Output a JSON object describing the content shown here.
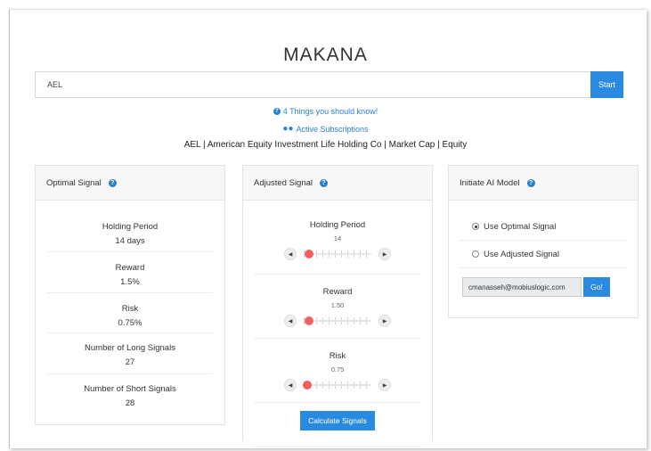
{
  "app": {
    "title": "MAKANA"
  },
  "search": {
    "value": "AEL",
    "start_label": "Start"
  },
  "links": {
    "things": "4 Things you should know!",
    "subscriptions": "Active Subscriptions"
  },
  "info_line": "AEL | American Equity Investment Life Holding Co | Market Cap | Equity",
  "optimal": {
    "title": "Optimal Signal",
    "items": [
      {
        "label": "Holding Period",
        "value": "14 days"
      },
      {
        "label": "Reward",
        "value": "1.5%"
      },
      {
        "label": "Risk",
        "value": "0.75%"
      },
      {
        "label": "Number of Long Signals",
        "value": "27"
      },
      {
        "label": "Number of Short Signals",
        "value": "28"
      }
    ]
  },
  "adjusted": {
    "title": "Adjusted Signal",
    "sliders": [
      {
        "label": "Holding Period",
        "value": "14",
        "position": 0.08
      },
      {
        "label": "Reward",
        "value": "1.50",
        "position": 0.08
      },
      {
        "label": "Risk",
        "value": "0.75",
        "position": 0.05
      }
    ],
    "calculate_label": "Calculate Signals"
  },
  "initiate": {
    "title": "Initiate AI Model",
    "options": [
      {
        "label": "Use Optimal Signal",
        "selected": true
      },
      {
        "label": "Use Adjusted Signal",
        "selected": false
      }
    ],
    "email_value": "cmanasseh@mobiuslogic.com",
    "go_label": "Go!"
  },
  "colors": {
    "accent": "#2a8ae0",
    "thumb": "#f06060",
    "panel_head": "#f7f7f7"
  },
  "icons": {
    "help": "question-circle-icon",
    "users": "users-icon",
    "arrow_left": "chevron-left-icon",
    "arrow_right": "chevron-right-icon"
  }
}
